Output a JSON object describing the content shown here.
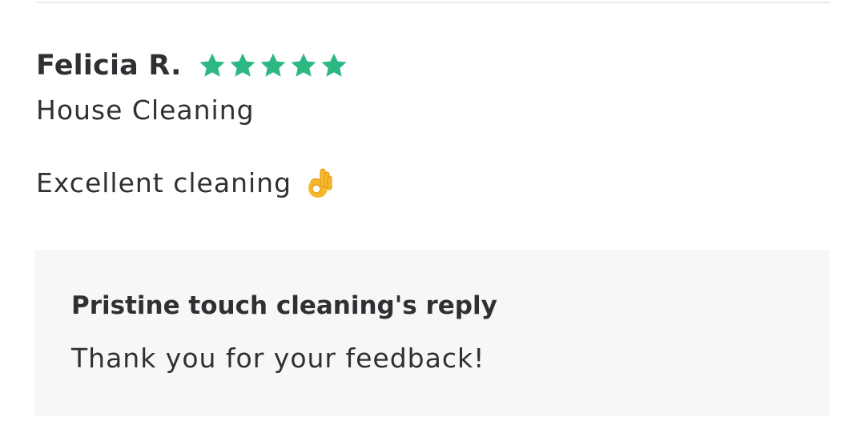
{
  "review": {
    "reviewer_name": "Felicia R.",
    "rating": 5,
    "rating_max": 5,
    "star_color": "#2db783",
    "service": "House Cleaning",
    "text": "Excellent cleaning",
    "emoji_icon": "ok-hand-icon"
  },
  "reply": {
    "title": "Pristine touch cleaning's reply",
    "text": "Thank you for your feedback!",
    "background": "#f7f7f7"
  }
}
